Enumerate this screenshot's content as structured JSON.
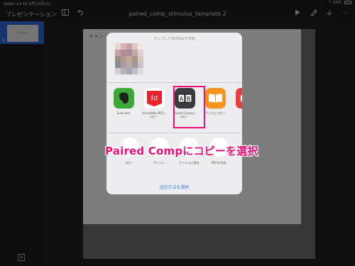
{
  "status_bar": {
    "carrier": "Safari",
    "time": "13:42",
    "date": "6月12日(火)",
    "battery": "33%"
  },
  "toolbar": {
    "presentation_label": "プレゼンテーション",
    "document_title": "paired_comp_stimulus_template 2",
    "icons": [
      "sidebar-icon",
      "undo-icon",
      "play-icon",
      "format-brush-icon",
      "plus-icon",
      "more-icon"
    ]
  },
  "navigator": {
    "slide_number": "1",
    "thumb_text": "文字を入力"
  },
  "canvas": {
    "cancel_label": "キャン"
  },
  "share_sheet": {
    "airdrop_caption": "タップしてAirDropで共有",
    "apps": [
      {
        "name": "Evernote",
        "label": "Evernote",
        "color": "#3aa935"
      },
      {
        "name": "iAnnotate",
        "label": "iAnnotate PDFに\nコピー",
        "color": "#e8212a"
      },
      {
        "name": "Paired Comp",
        "label": "Paired Compに\nコピー",
        "color": "#3b3b40"
      },
      {
        "name": "Books",
        "label": "ブックにコピー",
        "color": "#f7941d"
      },
      {
        "name": "Chrome",
        "label": "Cr",
        "color": "#e83d3d"
      }
    ],
    "actions": [
      {
        "label": "コピー"
      },
      {
        "label": "プリント"
      },
      {
        "label": "ファイルに保存"
      },
      {
        "label": "PDFを作成"
      }
    ],
    "send_method": "送信方法を選択"
  },
  "annotation": {
    "text": "Paired Compにコピーを選択",
    "color": "#ec0f7a"
  }
}
